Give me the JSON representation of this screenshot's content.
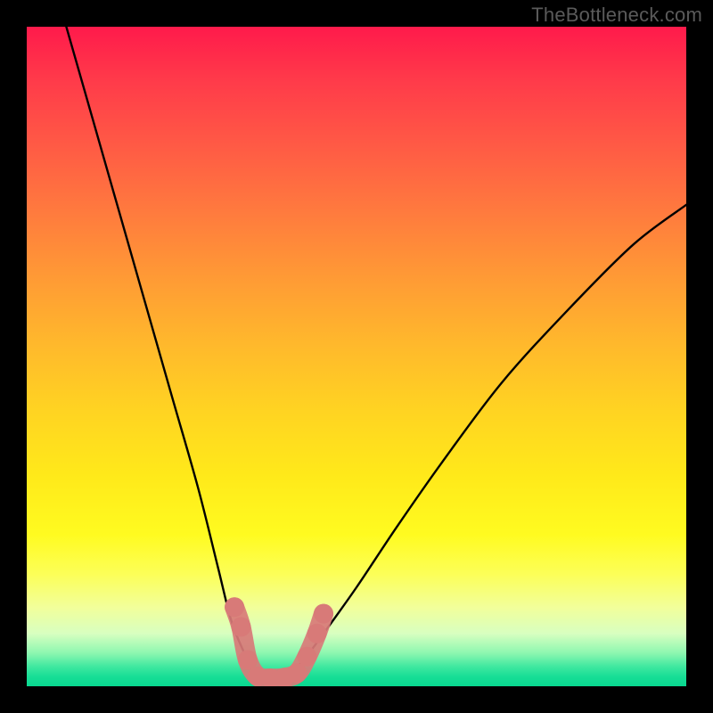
{
  "watermark": "TheBottleneck.com",
  "chart_data": {
    "type": "line",
    "title": "",
    "xlabel": "",
    "ylabel": "",
    "xlim": [
      0,
      100
    ],
    "ylim": [
      0,
      100
    ],
    "grid": false,
    "legend": false,
    "series": [
      {
        "name": "bottleneck-curve",
        "x": [
          6,
          10,
          14,
          18,
          22,
          26,
          29,
          31,
          33,
          34.5,
          36,
          38,
          40,
          42,
          45,
          50,
          56,
          63,
          72,
          82,
          92,
          100
        ],
        "y": [
          100,
          86,
          72,
          58,
          44,
          30,
          18,
          10,
          5,
          2,
          1,
          1,
          2,
          4,
          8,
          15,
          24,
          34,
          46,
          57,
          67,
          73
        ]
      }
    ],
    "marker_band": {
      "name": "optimal-band-markers",
      "color": "#d87a78",
      "points": [
        {
          "x": 31.5,
          "y": 12
        },
        {
          "x": 32.5,
          "y": 9
        },
        {
          "x": 33.5,
          "y": 4
        },
        {
          "x": 35.0,
          "y": 1.5
        },
        {
          "x": 37.0,
          "y": 1.2
        },
        {
          "x": 39.0,
          "y": 1.3
        },
        {
          "x": 41.0,
          "y": 2.0
        },
        {
          "x": 42.5,
          "y": 4.5
        },
        {
          "x": 44.0,
          "y": 8
        },
        {
          "x": 45.0,
          "y": 11
        }
      ]
    },
    "background_gradient": {
      "stops": [
        {
          "pos": 0,
          "color": "#ff1a4b"
        },
        {
          "pos": 0.5,
          "color": "#ffd322"
        },
        {
          "pos": 0.85,
          "color": "#fcff58"
        },
        {
          "pos": 1.0,
          "color": "#08d890"
        }
      ]
    }
  }
}
